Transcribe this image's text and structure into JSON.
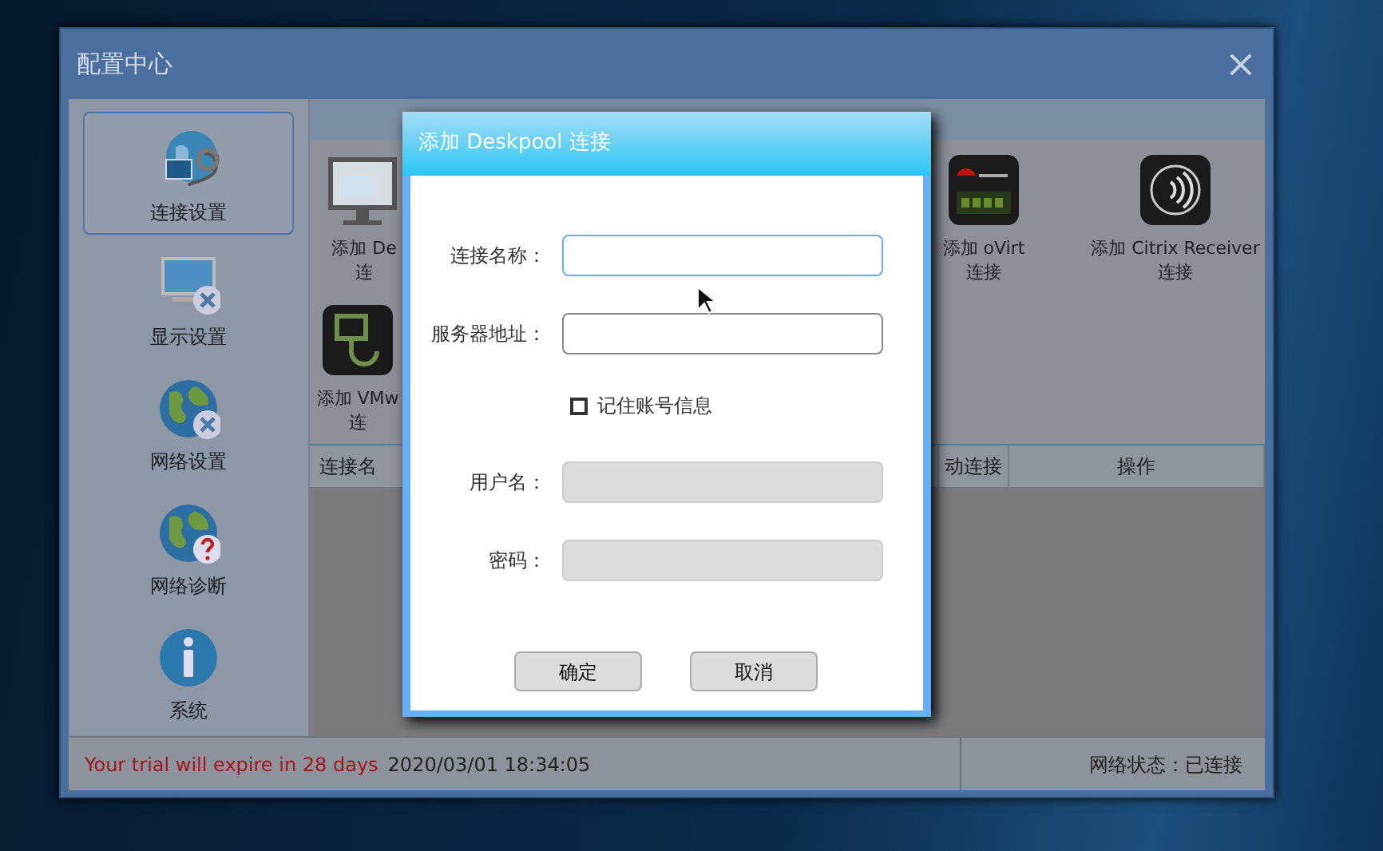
{
  "window": {
    "title": "配置中心",
    "close": "×"
  },
  "sidebar": {
    "items": [
      {
        "label": "连接设置",
        "kind": "connection",
        "selected": true
      },
      {
        "label": "显示设置",
        "kind": "display",
        "selected": false
      },
      {
        "label": "网络设置",
        "kind": "network",
        "selected": false
      },
      {
        "label": "网络诊断",
        "kind": "diagnose",
        "selected": false
      },
      {
        "label": "系统",
        "kind": "info",
        "selected": false
      }
    ]
  },
  "tiles": [
    {
      "lines": [
        "添加 De",
        "连"
      ],
      "kind": "monitor"
    },
    {
      "lines": [
        "添加 oVirt",
        "连接"
      ],
      "kind": "redhat"
    },
    {
      "lines": [
        "添加 Citrix Receiver",
        "连接"
      ],
      "kind": "citrix"
    },
    {
      "lines": [
        "添加 VMw",
        "连"
      ],
      "kind": "vmware"
    }
  ],
  "table": {
    "columns": [
      "连接名",
      "动连接",
      "操作"
    ]
  },
  "status_bar": {
    "trial": "Your trial will expire in 28 days",
    "datetime": "2020/03/01 18:34:05",
    "network": "网络状态：已连接"
  },
  "dialog": {
    "title": "添加 Deskpool 连接",
    "fields": [
      {
        "label": "连接名称：",
        "focused": true,
        "disabled": false
      },
      {
        "label": "服务器地址：",
        "focused": false,
        "disabled": false
      }
    ],
    "checkbox": {
      "label": "记住账号信息",
      "checked": false
    },
    "account_fields": [
      {
        "label": "用户名：",
        "disabled": true
      },
      {
        "label": "密码：",
        "disabled": true
      }
    ],
    "buttons": [
      "确定",
      "取消"
    ]
  }
}
